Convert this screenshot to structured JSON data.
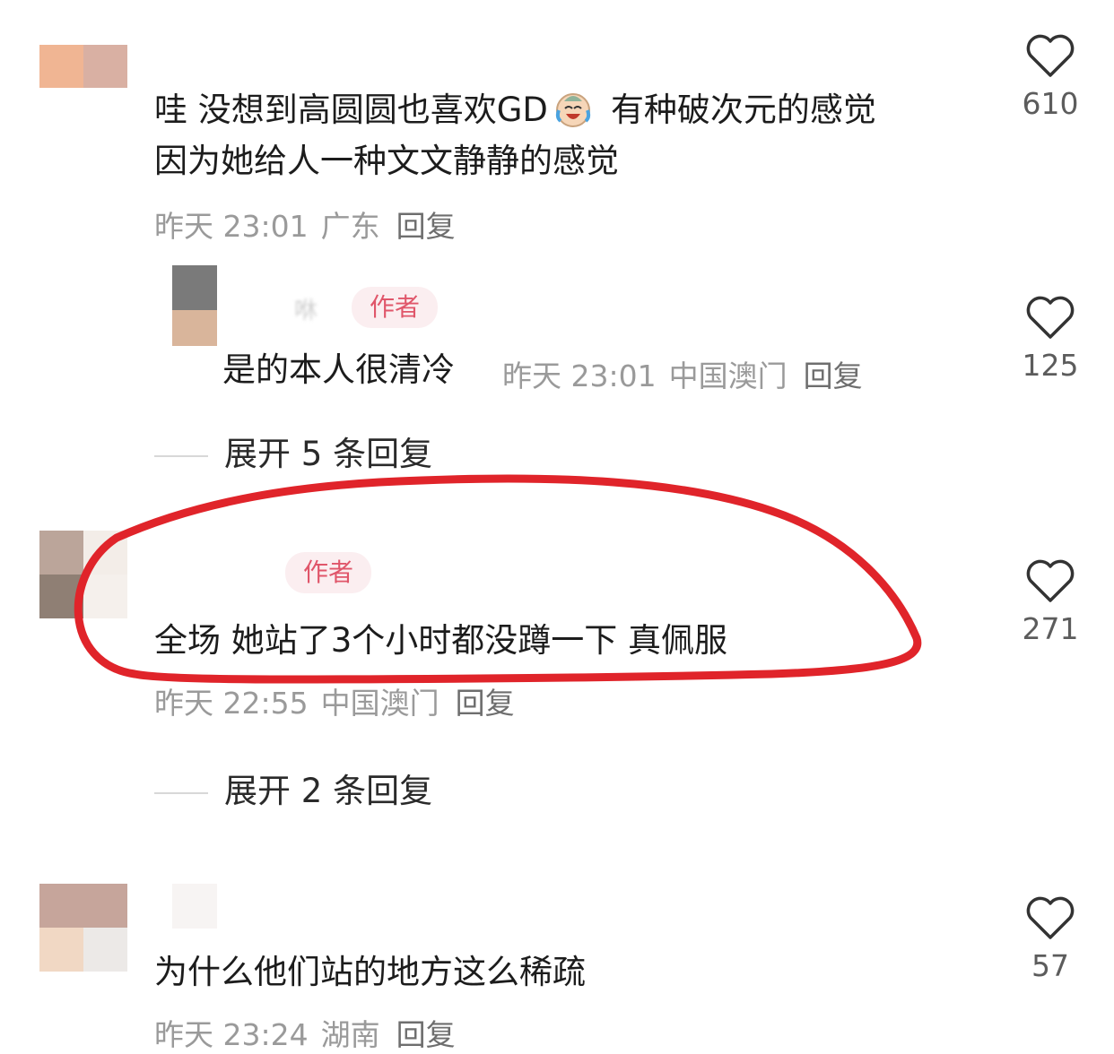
{
  "comments": [
    {
      "text_line1": "哇 没想到高圆圆也喜欢GD",
      "text_line1_after": "有种破次元的感觉",
      "text_line2": "因为她给人一种文文静静的感觉",
      "time": "昨天 23:01",
      "location": "广东",
      "reply_label": "回复",
      "likes": "610"
    },
    {
      "username_fragment": "咻",
      "badge": "作者",
      "text": "是的本人很清冷",
      "time": "昨天 23:01",
      "location": "中国澳门",
      "reply_label": "回复",
      "likes": "125",
      "expand": "展开 5 条回复"
    },
    {
      "badge": "作者",
      "text": "全场 她站了3个小时都没蹲一下 真佩服",
      "time": "昨天 22:55",
      "location": "中国澳门",
      "reply_label": "回复",
      "likes": "271",
      "expand": "展开 2 条回复"
    },
    {
      "text": "为什么他们站的地方这么稀疏",
      "time": "昨天 23:24",
      "location": "湖南",
      "reply_label": "回复",
      "likes": "57"
    }
  ],
  "colors": {
    "highlight_circle": "#e0242a",
    "badge_bg": "#fbeef0",
    "badge_text": "#e0566a",
    "meta_gray": "#9a9a9a"
  },
  "icons": [
    "heart-outline-icon",
    "crying-laughing-emoji"
  ]
}
